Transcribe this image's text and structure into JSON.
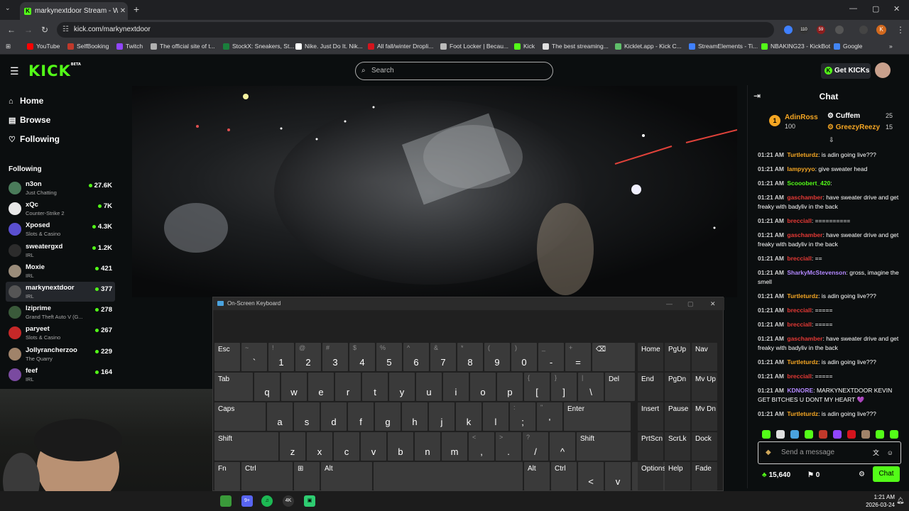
{
  "browser": {
    "tab_title": "markynextdoor Stream - W",
    "new_tab": "+",
    "url": "kick.com/markynextdoor",
    "window_controls": [
      "—",
      "▢",
      "✕"
    ],
    "ext_badges": [
      "110",
      "59"
    ],
    "profile_initial": "K",
    "bookmarks": [
      {
        "label": "YouTube",
        "color": "#ff0000"
      },
      {
        "label": "SelfBooking",
        "color": "#c0392b"
      },
      {
        "label": "Twitch",
        "color": "#9146ff"
      },
      {
        "label": "The official site of t...",
        "color": "#b0b0b0"
      },
      {
        "label": "StockX: Sneakers, St...",
        "color": "#1a7f3c"
      },
      {
        "label": "Nike. Just Do It. Nik...",
        "color": "#ffffff"
      },
      {
        "label": "All fall/winter Dropli...",
        "color": "#d4141d"
      },
      {
        "label": "Foot Locker | Becau...",
        "color": "#bbbbbb"
      },
      {
        "label": "Kick",
        "color": "#53fc18"
      },
      {
        "label": "The best streaming...",
        "color": "#e0e0e0"
      },
      {
        "label": "Kicklet.app - Kick C...",
        "color": "#5fbf6a"
      },
      {
        "label": "StreamElements - Ti...",
        "color": "#3f80ff"
      },
      {
        "label": "NBAKING23 - KickBot",
        "color": "#53fc18"
      },
      {
        "label": "Google",
        "color": "#4285f4"
      }
    ]
  },
  "kick": {
    "logo": "KICK",
    "logo_beta": "BETA",
    "search_placeholder": "Search",
    "get_kicks": "Get KICKs"
  },
  "sidebar": {
    "nav": [
      {
        "label": "Home",
        "icon": "home-icon"
      },
      {
        "label": "Browse",
        "icon": "browse-icon"
      },
      {
        "label": "Following",
        "icon": "heart-icon"
      }
    ],
    "following_header": "Following",
    "channels": [
      {
        "name": "n3on",
        "category": "Just Chatting",
        "viewers": "27.6K",
        "color": "#4a7b5a"
      },
      {
        "name": "xQc",
        "category": "Counter-Strike 2",
        "viewers": "7K",
        "color": "#e8e8e8"
      },
      {
        "name": "Xposed",
        "category": "Slots & Casino",
        "viewers": "4.3K",
        "color": "#5a4fcf"
      },
      {
        "name": "sweatergxd",
        "category": "IRL",
        "viewers": "1.2K",
        "color": "#2c2c2c"
      },
      {
        "name": "Moxie",
        "category": "IRL",
        "viewers": "421",
        "color": "#9a8c7a"
      },
      {
        "name": "markynextdoor",
        "category": "IRL",
        "viewers": "377",
        "color": "#555555"
      },
      {
        "name": "lziprime",
        "category": "Grand Theft Auto V (G...",
        "viewers": "278",
        "color": "#3a5a3a"
      },
      {
        "name": "paryeet",
        "category": "Slots & Casino",
        "viewers": "267",
        "color": "#c62828"
      },
      {
        "name": "Jollyrancherzoo",
        "category": "The Quarry",
        "viewers": "229",
        "color": "#a0836a"
      },
      {
        "name": "feef",
        "category": "IRL",
        "viewers": "164",
        "color": "#7a4aa0"
      }
    ]
  },
  "osk": {
    "title": "On-Screen Keyboard",
    "rows": [
      [
        {
          "label": "Esc",
          "w": 0
        },
        {
          "shift": "~",
          "main": "`"
        },
        {
          "shift": "!",
          "main": "1"
        },
        {
          "shift": "@",
          "main": "2"
        },
        {
          "shift": "#",
          "main": "3"
        },
        {
          "shift": "$",
          "main": "4"
        },
        {
          "shift": "%",
          "main": "5"
        },
        {
          "shift": "^",
          "main": "6"
        },
        {
          "shift": "&",
          "main": "7"
        },
        {
          "shift": "*",
          "main": "8"
        },
        {
          "shift": "(",
          "main": "9"
        },
        {
          "shift": ")",
          "main": "0"
        },
        {
          "shift": "_",
          "main": "-"
        },
        {
          "shift": "+",
          "main": "="
        },
        {
          "label": "⌫"
        }
      ]
    ],
    "nav_keys": [
      [
        "Home",
        "PgUp",
        "Nav"
      ],
      [
        "End",
        "PgDn",
        "Mv Up"
      ],
      [
        "Insert",
        "Pause",
        "Mv Dn"
      ],
      [
        "PrtScn",
        "ScrLk",
        "Dock"
      ],
      [
        "Options",
        "Help",
        "Fade"
      ]
    ],
    "row2": [
      "Tab",
      "q",
      "w",
      "e",
      "r",
      "t",
      "y",
      "u",
      "i",
      "o",
      "p",
      "[",
      "]",
      "\\",
      "Del"
    ],
    "row2_shift": [
      "",
      "",
      "",
      "",
      "",
      "",
      "",
      "",
      "",
      "",
      "",
      "{",
      "}",
      "|",
      ""
    ],
    "row3": [
      "Caps",
      "a",
      "s",
      "d",
      "f",
      "g",
      "h",
      "j",
      "k",
      "l",
      ";",
      "'",
      "Enter"
    ],
    "row3_shift": [
      "",
      "",
      "",
      "",
      "",
      "",
      "",
      "",
      "",
      "",
      ":",
      "\"",
      ""
    ],
    "row4": [
      "Shift",
      "z",
      "x",
      "c",
      "v",
      "b",
      "n",
      "m",
      ",",
      ".",
      "/",
      "^",
      "Shift"
    ],
    "row4_shift": [
      "",
      "",
      "",
      "",
      "",
      "",
      "",
      "",
      "<",
      ">",
      "?",
      "",
      ""
    ],
    "row5": [
      "Fn",
      "Ctrl",
      "⊞",
      "Alt",
      "",
      "Alt",
      "Ctrl",
      "<",
      "v",
      ">",
      "▤"
    ]
  },
  "chat": {
    "title": "Chat",
    "leaderboard": [
      {
        "rank": "1",
        "name": "AdinRoss",
        "value": "100",
        "name_color": "#f5a623"
      },
      {
        "name": "Cuffem",
        "value": "25",
        "name_color": "#ffffff"
      },
      {
        "name": "GreezyReezy",
        "value": "15",
        "name_color": "#f5a623"
      }
    ],
    "messages": [
      {
        "time": "01:21 AM",
        "user": "Turtleturdz",
        "color": "#f5a623",
        "text": ": is adin going live???"
      },
      {
        "time": "01:21 AM",
        "user": "lampyyyo",
        "color": "#f5a623",
        "text": ": give sweater head"
      },
      {
        "time": "01:21 AM",
        "user": "Scooobert_420",
        "color": "#53fc18",
        "text": ": "
      },
      {
        "time": "01:21 AM",
        "user": "gaschamber",
        "color": "#e53935",
        "text": ": have sweater drive and get freaky with badyliv in the back"
      },
      {
        "time": "01:21 AM",
        "user": "brecciall",
        "color": "#e53935",
        "text": ": =========="
      },
      {
        "time": "01:21 AM",
        "user": "gaschamber",
        "color": "#e53935",
        "text": ": have sweater drive and get freaky with badyliv in the back"
      },
      {
        "time": "01:21 AM",
        "user": "brecciall",
        "color": "#e53935",
        "text": ": =="
      },
      {
        "time": "01:21 AM",
        "user": "SharkyMcStevenson",
        "color": "#b388ff",
        "text": ": gross, imagine the smell"
      },
      {
        "time": "01:21 AM",
        "user": "Turtleturdz",
        "color": "#f5a623",
        "text": ": is adin going live???"
      },
      {
        "time": "01:21 AM",
        "user": "brecciall",
        "color": "#e53935",
        "text": ": ====="
      },
      {
        "time": "01:21 AM",
        "user": "brecciall",
        "color": "#e53935",
        "text": ": ====="
      },
      {
        "time": "01:21 AM",
        "user": "gaschamber",
        "color": "#e53935",
        "text": ": have sweater drive and get freaky with badyliv in the back"
      },
      {
        "time": "01:21 AM",
        "user": "Turtleturdz",
        "color": "#f5a623",
        "text": ": is adin going live???"
      },
      {
        "time": "01:21 AM",
        "user": "brecciall",
        "color": "#e53935",
        "text": ": ====="
      },
      {
        "time": "01:21 AM",
        "user": "KDNORE",
        "color": "#b388ff",
        "text": ": MARKYNEXTDOOR KEVIN GET BITCHES U DONT MY HEART 💜"
      },
      {
        "time": "01:21 AM",
        "user": "Turtleturdz",
        "color": "#f5a623",
        "text": ": is adin going live???"
      }
    ],
    "input_placeholder": "Send a message",
    "points": "15,640",
    "gifts": "0",
    "send_label": "Chat"
  },
  "taskbar": {
    "time": "1:21 AM",
    "date": "2026-03-24",
    "discord_badge": "9+",
    "obs_label": "4K"
  }
}
